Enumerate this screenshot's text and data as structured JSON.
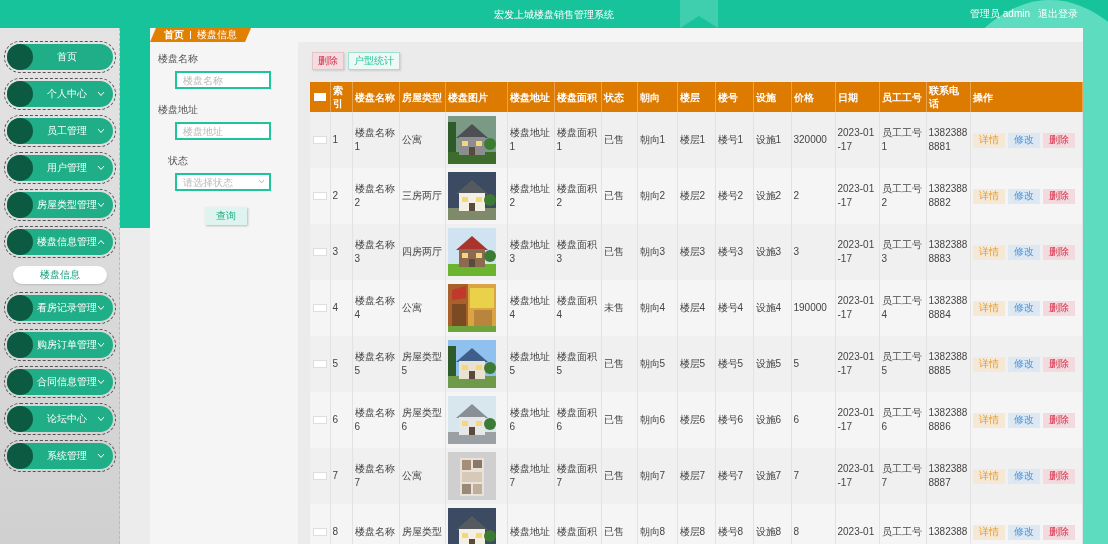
{
  "header": {
    "title": "宏发上城楼盘销售管理系统",
    "user": "管理员 admin",
    "logout": "退出登录"
  },
  "sidebar": {
    "items": [
      {
        "label": "首页",
        "kind": "link"
      },
      {
        "label": "个人中心",
        "kind": "menu",
        "expanded": false
      },
      {
        "label": "员工管理",
        "kind": "menu",
        "expanded": false
      },
      {
        "label": "用户管理",
        "kind": "menu",
        "expanded": false
      },
      {
        "label": "房屋类型管理",
        "kind": "menu",
        "expanded": false
      },
      {
        "label": "楼盘信息管理",
        "kind": "menu",
        "expanded": true,
        "children": [
          {
            "label": "楼盘信息",
            "selected": true
          }
        ]
      },
      {
        "label": "看房记录管理",
        "kind": "menu",
        "expanded": false
      },
      {
        "label": "购房订单管理",
        "kind": "menu",
        "expanded": false
      },
      {
        "label": "合同信息管理",
        "kind": "menu",
        "expanded": false
      },
      {
        "label": "论坛中心",
        "kind": "menu",
        "expanded": false
      },
      {
        "label": "系统管理",
        "kind": "menu",
        "expanded": false
      }
    ]
  },
  "breadcrumb": [
    "首页",
    "楼盘信息"
  ],
  "search": {
    "fields": [
      {
        "label": "楼盘名称",
        "placeholder": "楼盘名称",
        "kind": "text"
      },
      {
        "label": "楼盘地址",
        "placeholder": "楼盘地址",
        "kind": "text"
      },
      {
        "label": "状态",
        "placeholder": "请选择状态",
        "kind": "select"
      }
    ],
    "button": "查询"
  },
  "toolbar": [
    {
      "label": "删除",
      "kind": "danger"
    },
    {
      "label": "户型统计",
      "kind": "outline"
    }
  ],
  "table": {
    "select_all": {
      "checked": false
    },
    "columns": [
      "索引",
      "楼盘名称",
      "房屋类型",
      "楼盘图片",
      "楼盘地址",
      "楼盘面积",
      "状态",
      "朝向",
      "楼层",
      "楼号",
      "设施",
      "价格",
      "日期",
      "员工工号",
      "联系电话",
      "操作"
    ],
    "rows": [
      {
        "checked": false,
        "cells": [
          "1",
          "楼盘名称1",
          "公寓",
          null,
          "楼盘地址1",
          "楼盘面积1",
          "已售",
          "朝向1",
          "楼层1",
          "楼号1",
          "设施1",
          "320000",
          "2023-01-17",
          "员工工号1",
          "13823888881"
        ],
        "actions": [
          {
            "label": "详情",
            "kind": "detail"
          },
          {
            "label": "修改",
            "kind": "edit"
          },
          {
            "label": "删除",
            "kind": "delete"
          }
        ]
      },
      {
        "checked": false,
        "cells": [
          "2",
          "楼盘名称2",
          "三房两厅",
          null,
          "楼盘地址2",
          "楼盘面积2",
          "已售",
          "朝向2",
          "楼层2",
          "楼号2",
          "设施2",
          "2",
          "2023-01-17",
          "员工工号2",
          "13823888882"
        ],
        "actions": [
          {
            "label": "详情",
            "kind": "detail"
          },
          {
            "label": "修改",
            "kind": "edit"
          },
          {
            "label": "删除",
            "kind": "delete"
          }
        ]
      },
      {
        "checked": false,
        "cells": [
          "3",
          "楼盘名称3",
          "四房两厅",
          null,
          "楼盘地址3",
          "楼盘面积3",
          "已售",
          "朝向3",
          "楼层3",
          "楼号3",
          "设施3",
          "3",
          "2023-01-17",
          "员工工号3",
          "13823888883"
        ],
        "actions": [
          {
            "label": "详情",
            "kind": "detail"
          },
          {
            "label": "修改",
            "kind": "edit"
          },
          {
            "label": "删除",
            "kind": "delete"
          }
        ]
      },
      {
        "checked": false,
        "cells": [
          "4",
          "楼盘名称4",
          "公寓",
          null,
          "楼盘地址4",
          "楼盘面积4",
          "未售",
          "朝向4",
          "楼层4",
          "楼号4",
          "设施4",
          "190000",
          "2023-01-17",
          "员工工号4",
          "13823888884"
        ],
        "actions": [
          {
            "label": "详情",
            "kind": "detail"
          },
          {
            "label": "修改",
            "kind": "edit"
          },
          {
            "label": "删除",
            "kind": "delete"
          }
        ]
      },
      {
        "checked": false,
        "cells": [
          "5",
          "楼盘名称5",
          "房屋类型5",
          null,
          "楼盘地址5",
          "楼盘面积5",
          "已售",
          "朝向5",
          "楼层5",
          "楼号5",
          "设施5",
          "5",
          "2023-01-17",
          "员工工号5",
          "13823888885"
        ],
        "actions": [
          {
            "label": "详情",
            "kind": "detail"
          },
          {
            "label": "修改",
            "kind": "edit"
          },
          {
            "label": "删除",
            "kind": "delete"
          }
        ]
      },
      {
        "checked": false,
        "cells": [
          "6",
          "楼盘名称6",
          "房屋类型6",
          null,
          "楼盘地址6",
          "楼盘面积6",
          "已售",
          "朝向6",
          "楼层6",
          "楼号6",
          "设施6",
          "6",
          "2023-01-17",
          "员工工号6",
          "13823888886"
        ],
        "actions": [
          {
            "label": "详情",
            "kind": "detail"
          },
          {
            "label": "修改",
            "kind": "edit"
          },
          {
            "label": "删除",
            "kind": "delete"
          }
        ]
      },
      {
        "checked": false,
        "cells": [
          "7",
          "楼盘名称7",
          "公寓",
          null,
          "楼盘地址7",
          "楼盘面积7",
          "已售",
          "朝向7",
          "楼层7",
          "楼号7",
          "设施7",
          "7",
          "2023-01-17",
          "员工工号7",
          "13823888887"
        ],
        "actions": [
          {
            "label": "详情",
            "kind": "detail"
          },
          {
            "label": "修改",
            "kind": "edit"
          },
          {
            "label": "删除",
            "kind": "delete"
          }
        ]
      },
      {
        "checked": false,
        "cells": [
          "8",
          "楼盘名称",
          "房屋类型",
          null,
          "楼盘地址",
          "楼盘面积",
          "已售",
          "朝向8",
          "楼层8",
          "楼号8",
          "设施8",
          "8",
          "2023-01",
          "员工工号",
          "1382388"
        ],
        "actions": [
          {
            "label": "详情",
            "kind": "detail"
          },
          {
            "label": "修改",
            "kind": "edit"
          },
          {
            "label": "删除",
            "kind": "delete"
          }
        ]
      }
    ]
  }
}
